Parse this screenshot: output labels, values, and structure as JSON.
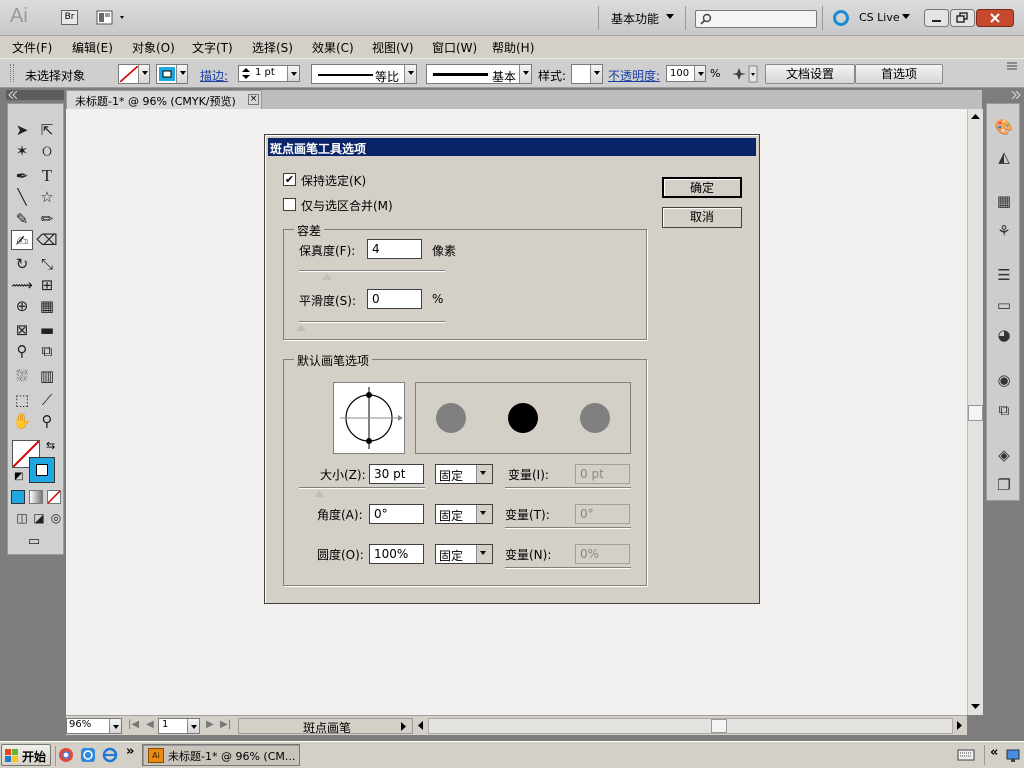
{
  "appbar": {
    "logo": "Ai",
    "bridge": "Br",
    "workspace": "基本功能",
    "search_placeholder": "",
    "cslive": "CS Live"
  },
  "menu": [
    "文件(F)",
    "编辑(E)",
    "对象(O)",
    "文字(T)",
    "选择(S)",
    "效果(C)",
    "视图(V)",
    "窗口(W)",
    "帮助(H)"
  ],
  "controlbar": {
    "selection": "未选择对象",
    "stroke_label": "描边:",
    "stroke_value": "1 pt",
    "profile1": "等比",
    "profile2": "基本",
    "style_label": "样式:",
    "opacity_label": "不透明度:",
    "opacity_value": "100",
    "opacity_unit": "%",
    "doc_setup": "文档设置",
    "preferences": "首选项"
  },
  "doctab": {
    "title": "未标题-1* @ 96% (CMYK/预览)"
  },
  "statusbar": {
    "zoom": "96%",
    "page": "1",
    "tool": "斑点画笔"
  },
  "dialog": {
    "title": "斑点画笔工具选项",
    "keep_selected": "保持选定(K)",
    "keep_selected_checked": true,
    "merge_only": "仅与选区合并(M)",
    "merge_only_checked": false,
    "ok": "确定",
    "cancel": "取消",
    "tolerance": {
      "group": "容差",
      "fidelity_label": "保真度(F):",
      "fidelity_value": "4",
      "fidelity_unit": "像素",
      "smooth_label": "平滑度(S):",
      "smooth_value": "0",
      "smooth_unit": "%"
    },
    "brush": {
      "group": "默认画笔选项",
      "size_label": "大小(Z):",
      "size_value": "30 pt",
      "size_mode": "固定",
      "size_var_label": "变量(I):",
      "size_var_value": "0 pt",
      "angle_label": "角度(A):",
      "angle_value": "0°",
      "angle_mode": "固定",
      "angle_var_label": "变量(T):",
      "angle_var_value": "0°",
      "round_label": "圆度(O):",
      "round_value": "100%",
      "round_mode": "固定",
      "round_var_label": "变量(N):",
      "round_var_value": "0%"
    }
  },
  "taskbar": {
    "start": "开始",
    "task": "未标题-1* @ 96% (CM..."
  }
}
